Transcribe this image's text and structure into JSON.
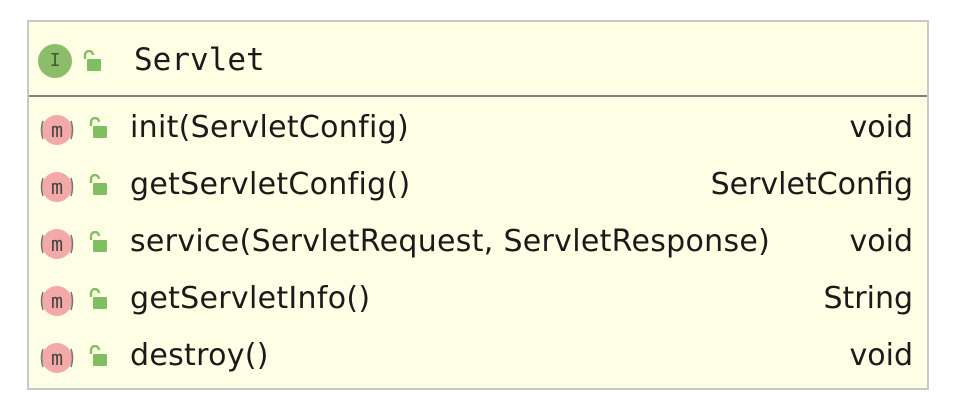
{
  "class_box": {
    "kind_badge": "I",
    "name": "Servlet",
    "methods": [
      {
        "badge": "m",
        "signature": "init(ServletConfig)",
        "return_type": "void"
      },
      {
        "badge": "m",
        "signature": "getServletConfig()",
        "return_type": "ServletConfig"
      },
      {
        "badge": "m",
        "signature": "service(ServletRequest, ServletResponse)",
        "return_type": "void"
      },
      {
        "badge": "m",
        "signature": "getServletInfo()",
        "return_type": "String"
      },
      {
        "badge": "m",
        "signature": "destroy()",
        "return_type": "void"
      }
    ]
  },
  "colors": {
    "box_background": "#fefee4",
    "interface_badge": "#8bbd6a",
    "method_badge": "#f4a9a9",
    "public_lock": "#7fbf5f"
  },
  "icons": {
    "interface": "interface-icon",
    "method": "method-icon",
    "visibility": "public-lock-icon"
  }
}
